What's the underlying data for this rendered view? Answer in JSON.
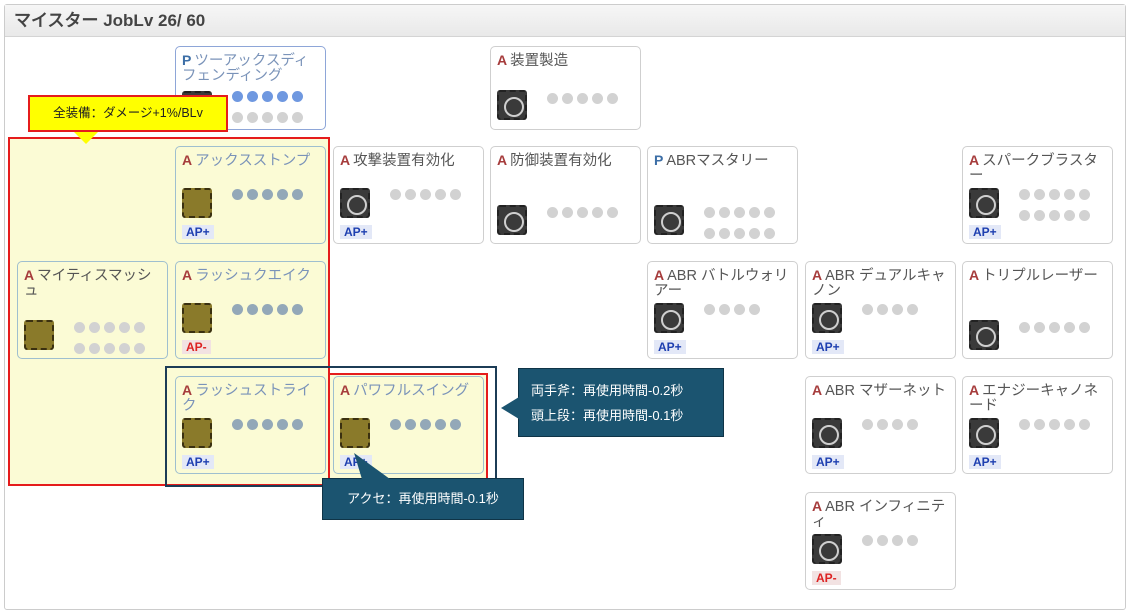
{
  "header": {
    "title": "マイスター JobLv 26/ 60"
  },
  "callouts": {
    "all_equip": "全装備：ダメージ+1%/BLv",
    "two_hand_line1": "両手斧：再使用時間-0.2秒",
    "two_hand_line2": "頭上段：再使用時間-0.1秒",
    "accessory": "アクセ：再使用時間-0.1秒"
  },
  "skills": {
    "two_ax_defending": {
      "type": "P",
      "name": "ツーアックスディフェンディング"
    },
    "device_making": {
      "type": "A",
      "name": "装置製造"
    },
    "ax_stomp": {
      "type": "A",
      "name": "アックスストンプ",
      "ap": "AP+"
    },
    "attack_device": {
      "type": "A",
      "name": "攻撃装置有効化",
      "ap": "AP+"
    },
    "defense_device": {
      "type": "A",
      "name": "防御装置有効化"
    },
    "abr_mastery": {
      "type": "P",
      "name": "ABRマスタリー"
    },
    "spark_blaster": {
      "type": "A",
      "name": "スパークブラスター",
      "ap": "AP+"
    },
    "mighty_smash": {
      "type": "A",
      "name": "マイティスマッシュ"
    },
    "rush_quake": {
      "type": "A",
      "name": "ラッシュクエイク",
      "ap": "AP-"
    },
    "abr_battle_warrior": {
      "type": "A",
      "name": "ABR バトルウォリアー",
      "ap": "AP+"
    },
    "abr_dual_cannon": {
      "type": "A",
      "name": "ABR デュアルキャノン",
      "ap": "AP+"
    },
    "triple_laser": {
      "type": "A",
      "name": "トリプルレーザー"
    },
    "rush_strike": {
      "type": "A",
      "name": "ラッシュストライク",
      "ap": "AP+"
    },
    "powerful_swing": {
      "type": "A",
      "name": "パワフルスイング",
      "ap": "AP+"
    },
    "abr_mother_net": {
      "type": "A",
      "name": "ABR マザーネット",
      "ap": "AP+"
    },
    "energy_cannonade": {
      "type": "A",
      "name": "エナジーキャノネード",
      "ap": "AP+"
    },
    "abr_infinity": {
      "type": "A",
      "name": "ABR インフィニティ",
      "ap": "AP-"
    }
  }
}
